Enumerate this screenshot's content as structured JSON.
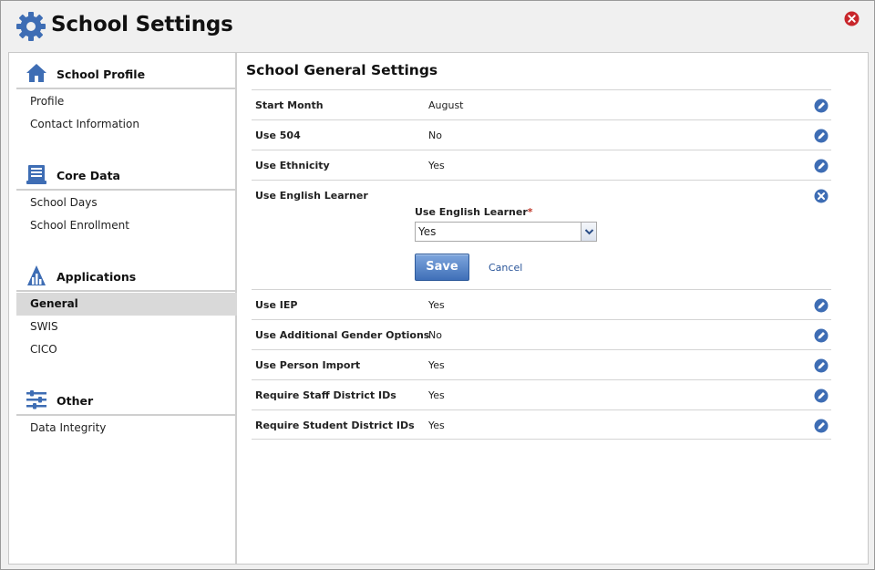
{
  "window": {
    "title": "School Settings"
  },
  "sidebar": {
    "sections": [
      {
        "label": "School Profile",
        "icon": "house-icon",
        "items": [
          "Profile",
          "Contact Information"
        ]
      },
      {
        "label": "Core Data",
        "icon": "database-document-icon",
        "items": [
          "School Days",
          "School Enrollment"
        ]
      },
      {
        "label": "Applications",
        "icon": "applications-icon",
        "items": [
          "General",
          "SWIS",
          "CICO"
        ]
      },
      {
        "label": "Other",
        "icon": "sliders-icon",
        "items": [
          "Data Integrity"
        ]
      }
    ],
    "active_item": "General"
  },
  "main": {
    "title": "School General Settings",
    "rows": [
      {
        "label": "Start Month",
        "value": "August"
      },
      {
        "label": "Use 504",
        "value": "No"
      },
      {
        "label": "Use Ethnicity",
        "value": "Yes"
      },
      {
        "label": "Use English Learner",
        "value": ""
      },
      {
        "label": "Use IEP",
        "value": "Yes"
      },
      {
        "label": "Use Additional Gender Options",
        "value": "No"
      },
      {
        "label": "Use Person Import",
        "value": "Yes"
      },
      {
        "label": "Require Staff District IDs",
        "value": "Yes"
      },
      {
        "label": "Require Student District IDs",
        "value": "Yes"
      }
    ],
    "editor": {
      "field_label": "Use English Learner",
      "required_mark": "*",
      "selected_value": "Yes",
      "save_label": "Save",
      "cancel_label": "Cancel"
    }
  },
  "colors": {
    "accent_blue": "#3f6fb8",
    "close_red": "#c8262b",
    "active_nav_bg": "#d9d9d9"
  }
}
